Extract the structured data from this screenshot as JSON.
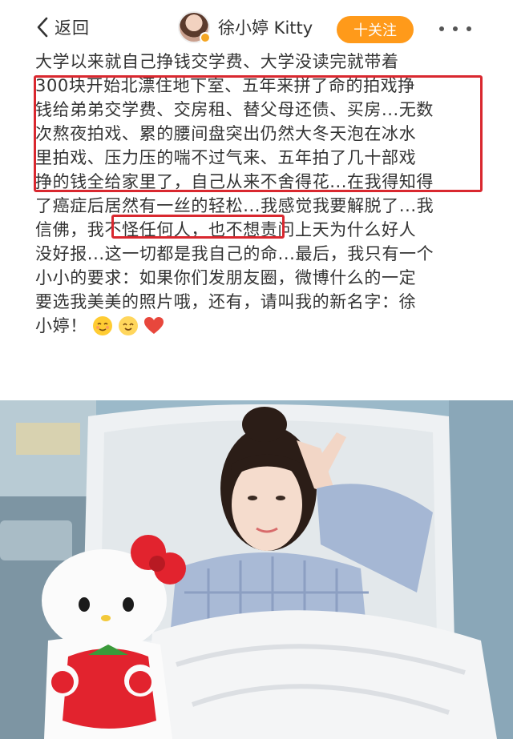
{
  "header": {
    "back_label": "返回",
    "username": "徐小婷 Kitty",
    "follow_label": "十关注"
  },
  "post": {
    "lines": [
      "大学以来就自己挣钱交学费、大学没读完就带着",
      "300块开始北漂住地下室、五年来拼了命的拍戏挣",
      "钱给弟弟交学费、交房租、替父母还债、买房...无数",
      "次熬夜拍戏、累的腰间盘突出仍然大冬天泡在冰水",
      "里拍戏、压力压的喘不过气来、五年拍了几十部戏",
      "挣的钱全给家里了，自己从来不舍得花...在我得知得",
      "了癌症后居然有一丝的轻松...我感觉我要解脱了...我",
      "信佛，我不怪任何人，也不想责问上天为什么好人",
      "没好报...这一切都是我自己的命...最后，我只有一个",
      "小小的要求：如果你们发朋友圈，微博什么的一定",
      "要选我美美的照片哦，还有，请叫我的新名字：徐",
      "小婷！"
    ]
  },
  "colors": {
    "follow": "#ff9a1a",
    "highlight": "#d9282f"
  },
  "icons": {
    "back": "chevron-left-icon",
    "more": "more-dots-icon",
    "emojis": [
      "relieved-face-emoji",
      "smiling-face-emoji",
      "red-heart-emoji"
    ]
  }
}
